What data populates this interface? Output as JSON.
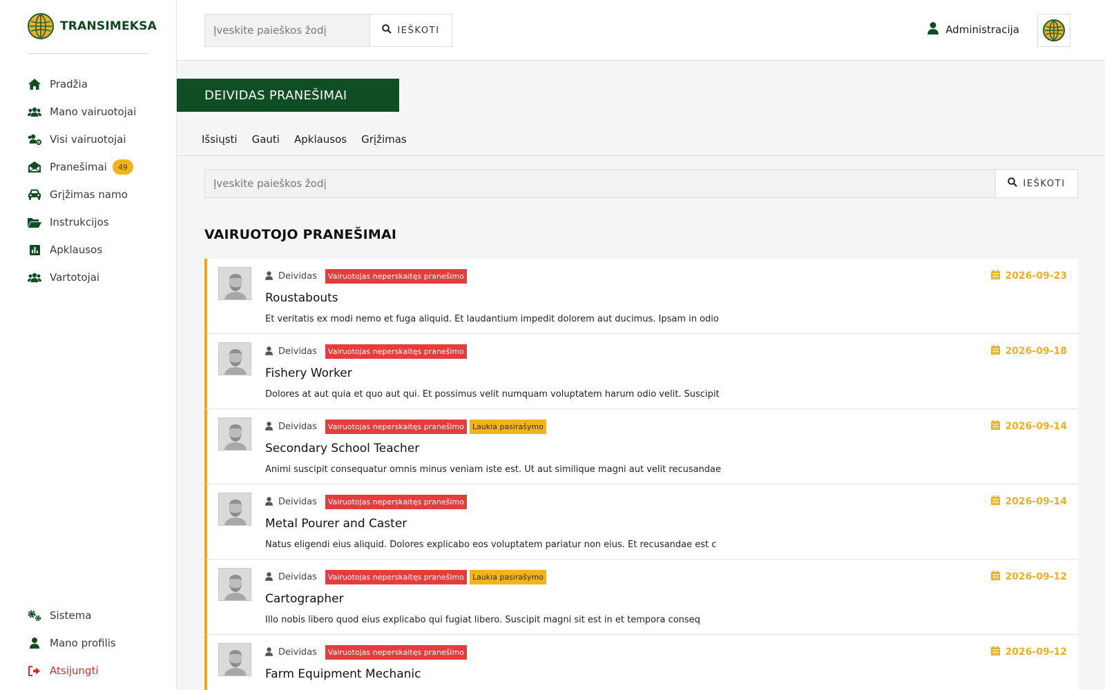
{
  "brand": {
    "name": "TRANSIMEKSA"
  },
  "sidebar": {
    "items": [
      {
        "label": "Pradžia",
        "icon": "home-icon"
      },
      {
        "label": "Mano vairuotojai",
        "icon": "users-icon"
      },
      {
        "label": "Visi vairuotojai",
        "icon": "users-cog-icon"
      },
      {
        "label": "Pranešimai",
        "icon": "envelope-open-icon",
        "badge": "49"
      },
      {
        "label": "Grįžimas namo",
        "icon": "car-icon"
      },
      {
        "label": "Instrukcijos",
        "icon": "folder-open-icon"
      },
      {
        "label": "Apklausos",
        "icon": "poll-icon"
      },
      {
        "label": "Vartotojai",
        "icon": "users-icon"
      }
    ],
    "bottom": [
      {
        "label": "Sistema",
        "icon": "cogs-icon"
      },
      {
        "label": "Mano profilis",
        "icon": "user-icon"
      },
      {
        "label": "Atsijungti",
        "icon": "sign-out-icon"
      }
    ]
  },
  "topbar": {
    "search_placeholder": "Įveskite paieškos žodį",
    "search_button": "IEŠKOTI",
    "user_label": "Administracija"
  },
  "page": {
    "header": "DEIVIDAS PRANEŠIMAI",
    "tabs": [
      "Išsiųsti",
      "Gauti",
      "Apklausos",
      "Grįžimas"
    ],
    "search_placeholder": "Įveskite paieškos žodį",
    "search_button": "IEŠKOTI",
    "section_title": "VAIRUOTOJO PRANEŠIMAI"
  },
  "colors": {
    "brand_green": "#0f4d22",
    "accent_yellow": "#f1a516",
    "tag_red": "#e53c3c",
    "logout_red": "#d62b2b"
  },
  "messages": [
    {
      "author": "Deividas",
      "tags": [
        {
          "text": "Vairuotojas neperskaitęs pranešimo",
          "color": "red"
        }
      ],
      "date": "2026-09-23",
      "title": "Roustabouts",
      "body": "Et veritatis ex modi nemo et fuga aliquid. Et laudantium impedit dolorem aut ducimus. Ipsam in odio"
    },
    {
      "author": "Deividas",
      "tags": [
        {
          "text": "Vairuotojas neperskaitęs pranešimo",
          "color": "red"
        }
      ],
      "date": "2026-09-18",
      "title": "Fishery Worker",
      "body": "Dolores at aut quia et quo aut qui. Et possimus velit numquam voluptatem harum odio velit. Suscipit"
    },
    {
      "author": "Deividas",
      "tags": [
        {
          "text": "Vairuotojas neperskaitęs pranešimo",
          "color": "red"
        },
        {
          "text": "Laukia pasirašymo",
          "color": "yellow"
        }
      ],
      "date": "2026-09-14",
      "title": "Secondary School Teacher",
      "body": "Animi suscipit consequatur omnis minus veniam iste est. Ut aut similique magni aut velit recusandae"
    },
    {
      "author": "Deividas",
      "tags": [
        {
          "text": "Vairuotojas neperskaitęs pranešimo",
          "color": "red"
        }
      ],
      "date": "2026-09-14",
      "title": "Metal Pourer and Caster",
      "body": "Natus eligendi eius aliquid. Dolores explicabo eos voluptatem pariatur non eius. Et recusandae est c"
    },
    {
      "author": "Deividas",
      "tags": [
        {
          "text": "Vairuotojas neperskaitęs pranešimo",
          "color": "red"
        },
        {
          "text": "Laukia pasirašymo",
          "color": "yellow"
        }
      ],
      "date": "2026-09-12",
      "title": "Cartographer",
      "body": "Illo nobis libero quod eius explicabo qui fugiat libero. Suscipit magni sit est in et tempora conseq"
    },
    {
      "author": "Deividas",
      "tags": [
        {
          "text": "Vairuotojas neperskaitęs pranešimo",
          "color": "red"
        }
      ],
      "date": "2026-09-12",
      "title": "Farm Equipment Mechanic",
      "body": ""
    }
  ]
}
